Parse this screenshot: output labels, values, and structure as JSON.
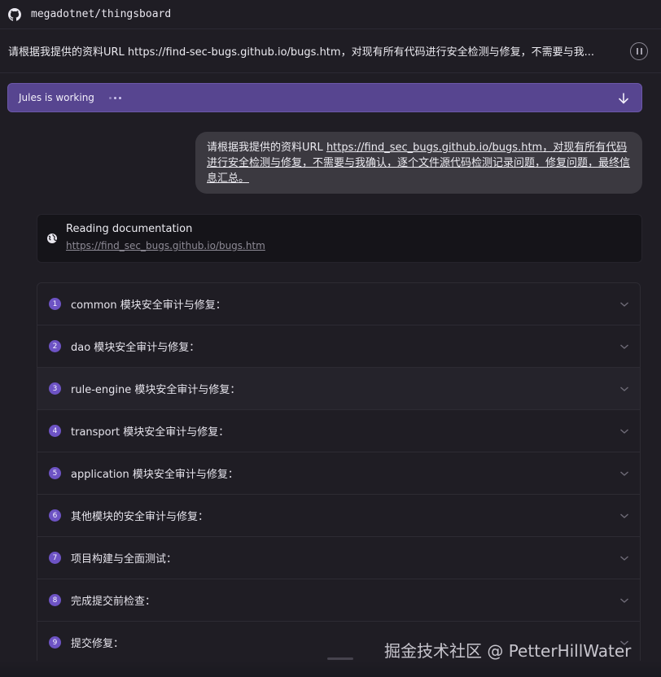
{
  "repo": {
    "name": "megadotnet/thingsboard"
  },
  "task": {
    "text": "请根据我提供的资料URL https://find-sec-bugs.github.io/bugs.htm，对现有所有代码进行安全检测与修复，不需要与我..."
  },
  "status": {
    "label": "Jules is working"
  },
  "message": {
    "prefix": "请根据我提供的资料URL ",
    "link": "https://find_sec_bugs.github.io/bugs.htm",
    "suffix": "，对现有所有代码进行安全检测与修复，不需要与我确认，逐个文件源代码检测记录问题，修复问题，最终信息汇总。"
  },
  "doc": {
    "title": "Reading documentation",
    "url": "https://find_sec_bugs.github.io/bugs.htm"
  },
  "steps": [
    {
      "num": "1",
      "label": "common 模块安全审计与修复："
    },
    {
      "num": "2",
      "label": "dao 模块安全审计与修复："
    },
    {
      "num": "3",
      "label": "rule-engine 模块安全审计与修复："
    },
    {
      "num": "4",
      "label": "transport 模块安全审计与修复："
    },
    {
      "num": "5",
      "label": "application 模块安全审计与修复："
    },
    {
      "num": "6",
      "label": "其他模块的安全审计与修复："
    },
    {
      "num": "7",
      "label": "项目构建与全面测试："
    },
    {
      "num": "8",
      "label": "完成提交前检查："
    },
    {
      "num": "9",
      "label": "提交修复："
    }
  ],
  "watermark": {
    "text": "掘金技术社区 @ PetterHillWater"
  },
  "icons": {
    "repo": "github-icon",
    "pause": "pause-icon",
    "scroll": "arrow-down-icon",
    "doc": "globe-icon",
    "step_toggle": "chevron-down-icon"
  },
  "colors": {
    "accent": "#574590",
    "step_badge": "#6d53c4",
    "background": "#1f1d24"
  }
}
